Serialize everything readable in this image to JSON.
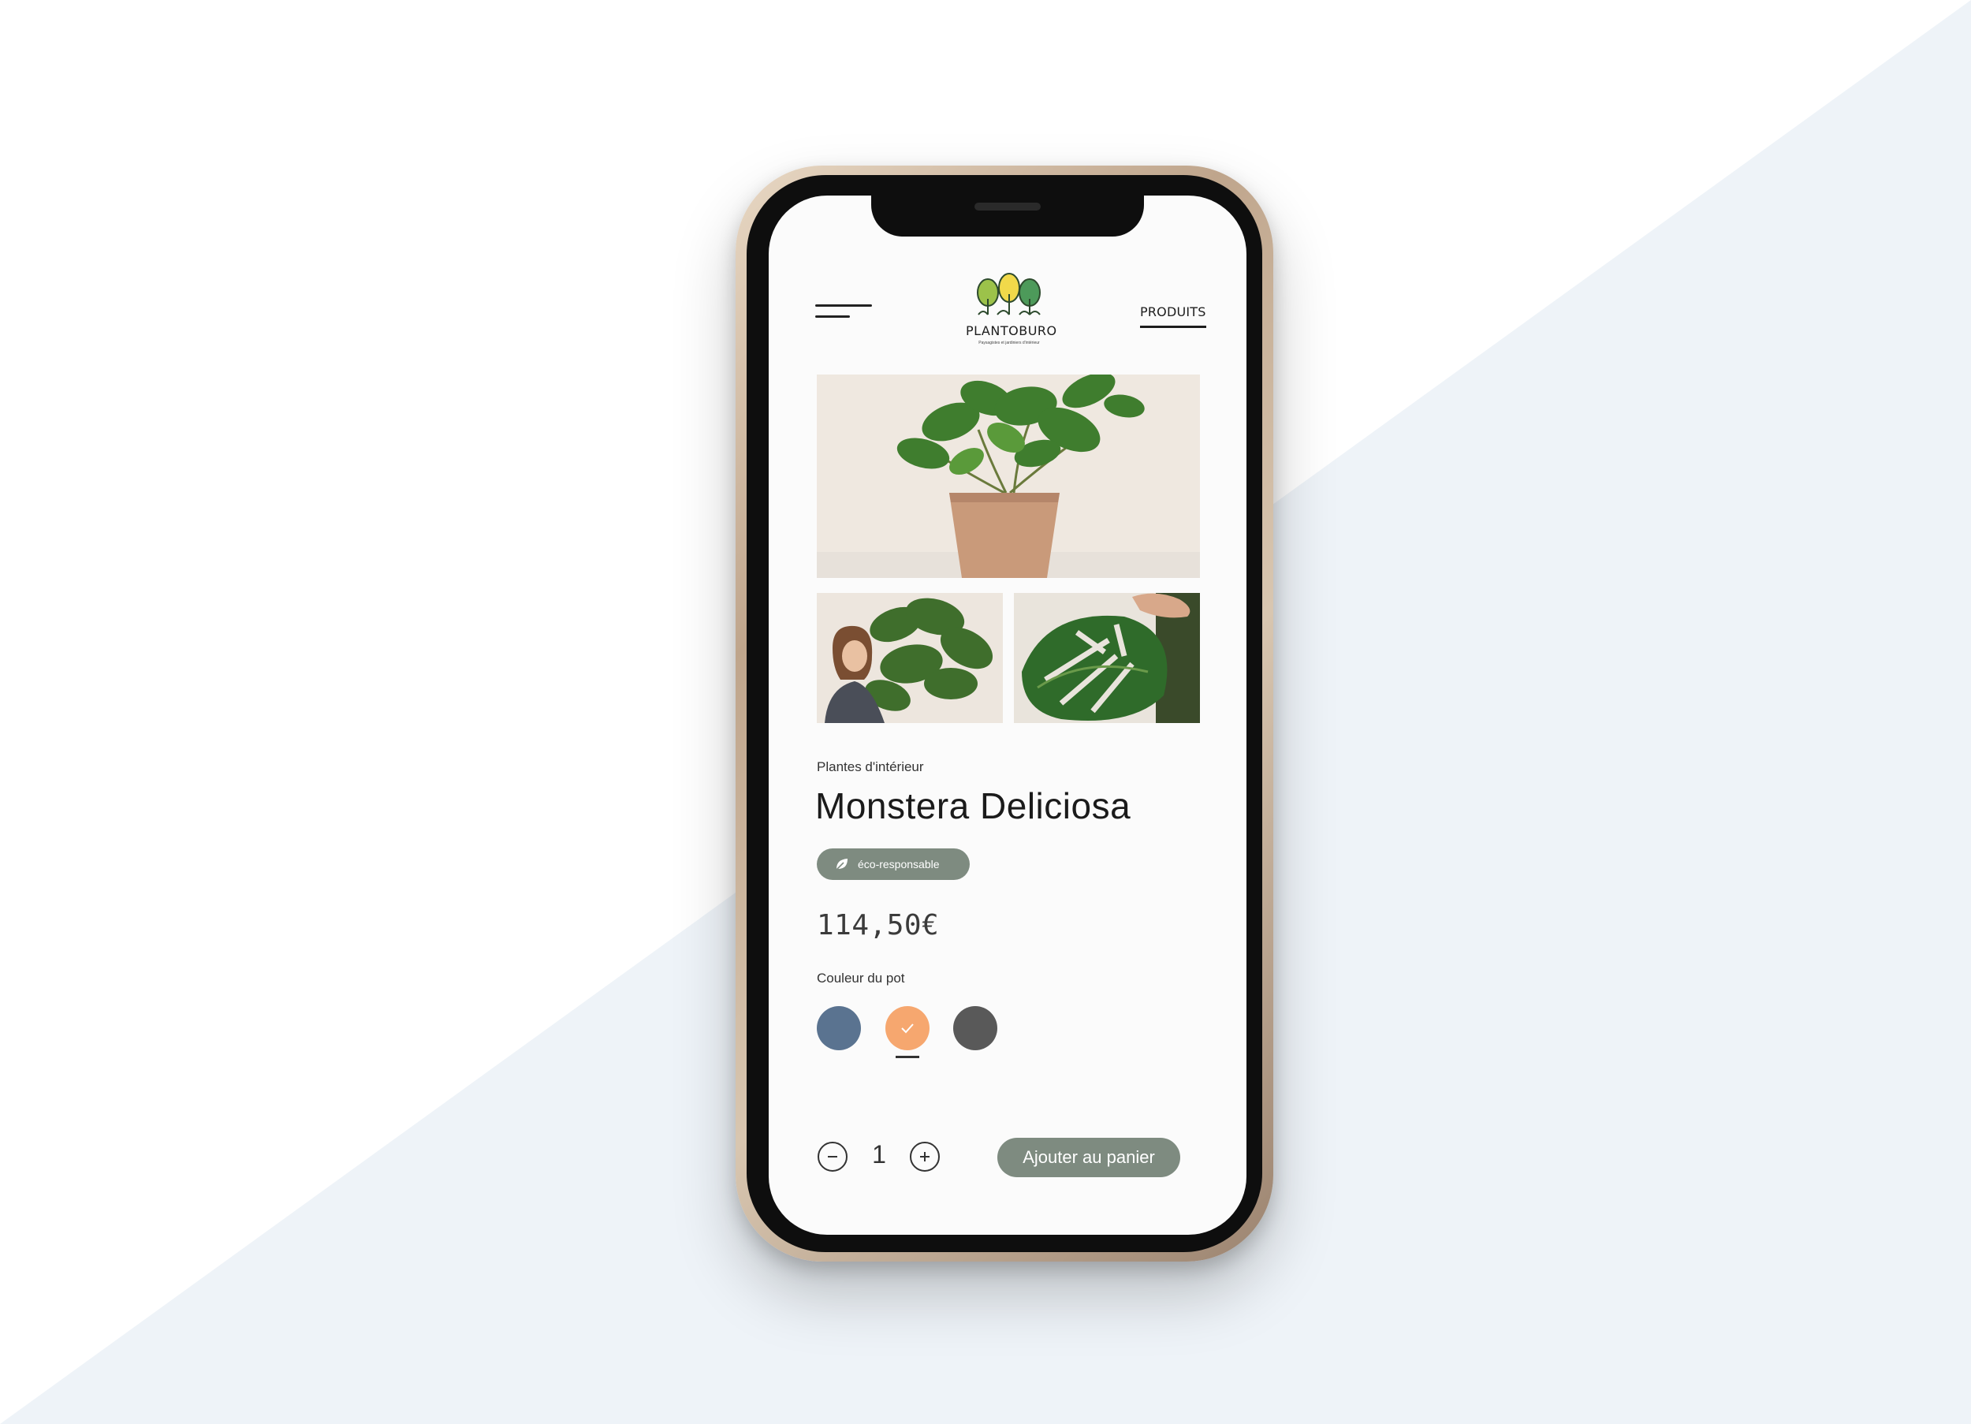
{
  "colors": {
    "background_light": "#eef3f8",
    "accent_green": "#7e8b80",
    "text_dark": "#1b1b1b"
  },
  "header": {
    "menu_icon": "hamburger-menu-icon",
    "logo": {
      "name": "PLANTOBURO",
      "tagline": "Paysagistes et jardiniers d'intérieur"
    },
    "nav_link": "PRODUITS"
  },
  "gallery": {
    "main": "monstera-plant-in-pot",
    "thumbnails": [
      "woman-with-monstera",
      "hand-touching-monstera-leaf"
    ]
  },
  "product": {
    "category": "Plantes d'intérieur",
    "name": "Monstera Deliciosa",
    "badge": {
      "icon": "leaf-icon",
      "label": "éco-responsable"
    },
    "price": "114,50€",
    "pot_color_label": "Couleur du pot",
    "pot_colors": [
      {
        "name": "blue",
        "hex": "#5a7390",
        "selected": false
      },
      {
        "name": "orange",
        "hex": "#f6a76f",
        "selected": true
      },
      {
        "name": "gray",
        "hex": "#595959",
        "selected": false
      }
    ]
  },
  "cart": {
    "quantity": "1",
    "minus_icon": "minus-circle-icon",
    "plus_icon": "plus-circle-icon",
    "add_button_label": "Ajouter au panier"
  }
}
